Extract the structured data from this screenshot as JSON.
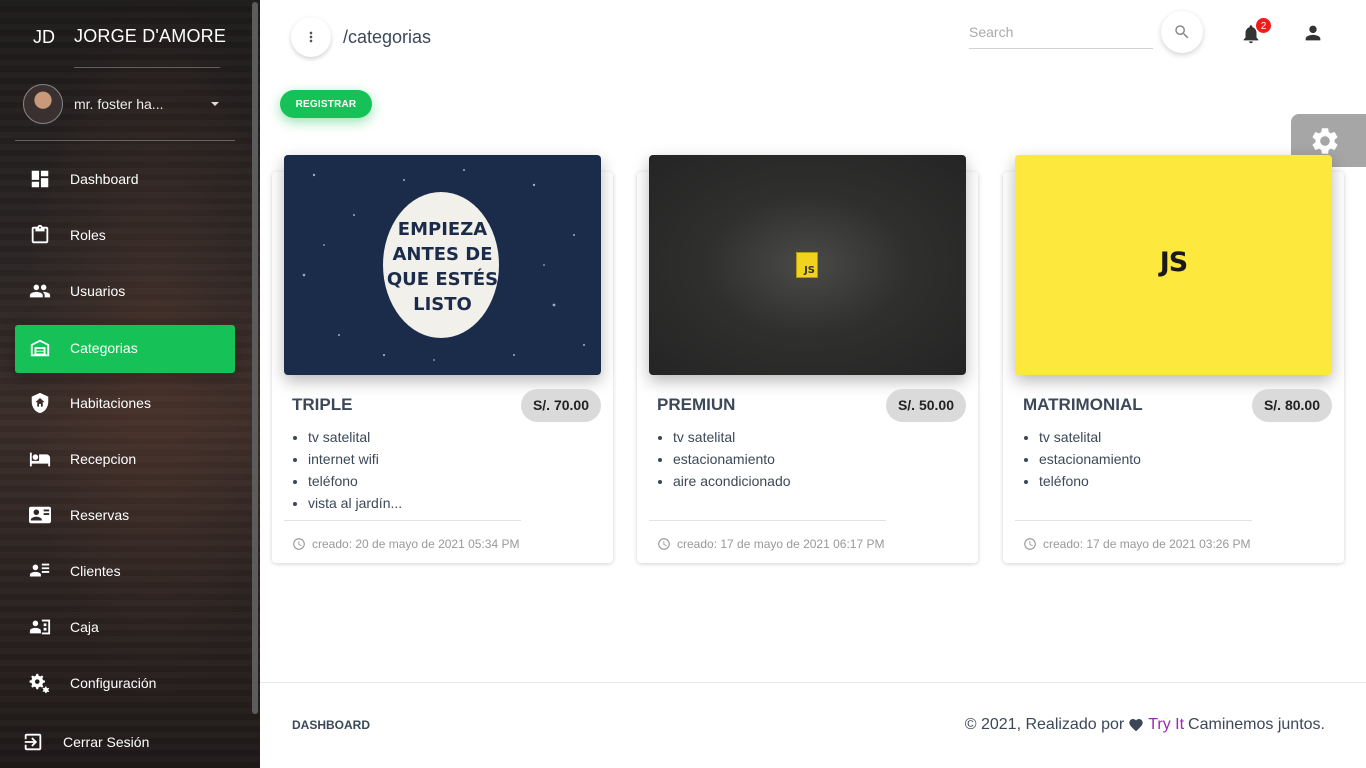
{
  "sidebar": {
    "brand_mini": "JD",
    "brand_name": "JORGE D'AMORE",
    "user_name": "mr. foster ha...",
    "items": [
      {
        "label": "Dashboard",
        "icon": "dashboard-icon"
      },
      {
        "label": "Roles",
        "icon": "clipboard-icon"
      },
      {
        "label": "Usuarios",
        "icon": "people-icon"
      },
      {
        "label": "Categorias",
        "icon": "warehouse-icon",
        "active": true
      },
      {
        "label": "Habitaciones",
        "icon": "shield-home-icon"
      },
      {
        "label": "Recepcion",
        "icon": "bed-icon"
      },
      {
        "label": "Reservas",
        "icon": "id-card-icon"
      },
      {
        "label": "Clientes",
        "icon": "person-list-icon"
      },
      {
        "label": "Caja",
        "icon": "cash-register-icon"
      },
      {
        "label": "Configuración",
        "icon": "gears-icon"
      }
    ],
    "logout": "Cerrar Sesión"
  },
  "header": {
    "breadcrumb": "/categorias",
    "search_placeholder": "Search",
    "notification_count": "2"
  },
  "actions": {
    "register": "REGISTRAR"
  },
  "cards": [
    {
      "title": "TRIPLE",
      "price": "S/. 70.00",
      "image": {
        "type": "poster",
        "lines": [
          "EMPIEZA",
          "ANTES DE",
          "QUE ESTÉS",
          "LISTO"
        ]
      },
      "features": [
        "tv satelital",
        "internet wifi",
        "teléfono",
        "vista al jardín..."
      ],
      "created": "creado: 20 de mayo de 2021 05:34 PM"
    },
    {
      "title": "PREMIUN",
      "price": "S/. 50.00",
      "image": {
        "type": "js-dark",
        "logo": "JS"
      },
      "features": [
        "tv satelital",
        "estacionamiento",
        "aire acondicionado"
      ],
      "created": "creado: 17 de mayo de 2021 06:17 PM"
    },
    {
      "title": "MATRIMONIAL",
      "price": "S/. 80.00",
      "image": {
        "type": "js-yellow",
        "logo": "JS"
      },
      "features": [
        "tv satelital",
        "estacionamiento",
        "teléfono"
      ],
      "created": "creado: 17 de mayo de 2021 03:26 PM"
    }
  ],
  "footer": {
    "link": "DASHBOARD",
    "copy_prefix": "© 2021, Realizado por",
    "brand": "Try It",
    "copy_suffix": "Caminemos juntos."
  },
  "colors": {
    "accent": "#16c257",
    "badge": "#f11b1b",
    "brand_link": "#9c27b0"
  }
}
